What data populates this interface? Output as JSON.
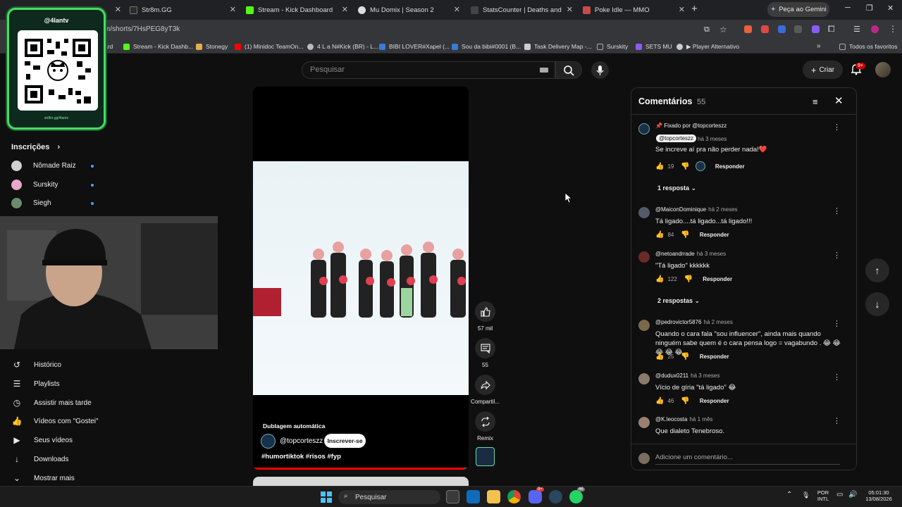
{
  "browser": {
    "tabs": [
      {
        "label": "",
        "color": "#555555"
      },
      {
        "label": "Str8m.GG",
        "color": "#2b2b2b"
      },
      {
        "label": "Stream - Kick Dashboard",
        "color": "#53fc18"
      },
      {
        "label": "Mu Domix | Season 2",
        "color": "#dddddd"
      },
      {
        "label": "StatsCounter | Deaths and trop",
        "color": "#444444"
      },
      {
        "label": "Poke Idle — MMO",
        "color": "#c94a4a"
      }
    ],
    "gemini_label": "Peça ao Gemini",
    "url": "m/shorts/7HsPEG8yT3k",
    "bookmarks": [
      {
        "label": "ard",
        "color": "#53fc18"
      },
      {
        "label": "Stream - Kick Dashb...",
        "color": "#53fc18"
      },
      {
        "label": "Stonegy",
        "color": "#e0b050"
      },
      {
        "label": "(1) Minidoc TeamOn...",
        "color": "#ff0000"
      },
      {
        "label": "4 L a N#Kick (BR) - L...",
        "color": "#bbbbbb"
      },
      {
        "label": "BIBI LOVER#Xapel (...",
        "color": "#3a7bd5"
      },
      {
        "label": "Sou da bibi#0001 (B...",
        "color": "#3a7bd5"
      },
      {
        "label": "Task Delivery Map -...",
        "color": "#cccccc"
      },
      {
        "label": "Surskity",
        "color": "#888888"
      },
      {
        "label": "SETS MU",
        "color": "#8b5cf6"
      },
      {
        "label": "▶ Player Alternativo",
        "color": "#cccccc"
      }
    ],
    "all_favorites": "Todos os favoritos"
  },
  "header": {
    "search_placeholder": "Pesquisar",
    "create_label": "Criar",
    "notif_badge": "9+"
  },
  "qr_overlay": {
    "title": "@4lantv",
    "link": "str8m.gg/4lantv"
  },
  "sidebar": {
    "subscriptions_title": "Inscrições",
    "subscriptions": [
      {
        "name": "Nômade Raiz",
        "color": "#cfcfcf"
      },
      {
        "name": "Surskity",
        "color": "#e9a8c8"
      },
      {
        "name": "Siegh",
        "color": "#6e8b6e"
      }
    ],
    "nav": [
      {
        "label": "Histórico",
        "icon": "history-icon",
        "glyph": "↺"
      },
      {
        "label": "Playlists",
        "icon": "playlists-icon",
        "glyph": "☰"
      },
      {
        "label": "Assistir mais tarde",
        "icon": "watch-later-icon",
        "glyph": "◷"
      },
      {
        "label": "Vídeos com \"Gostei\"",
        "icon": "thumbs-up-icon",
        "glyph": "👍"
      },
      {
        "label": "Seus vídeos",
        "icon": "your-videos-icon",
        "glyph": "▶"
      },
      {
        "label": "Downloads",
        "icon": "download-icon",
        "glyph": "↓"
      },
      {
        "label": "Mostrar mais",
        "icon": "chevron-down-icon",
        "glyph": "⌄"
      }
    ]
  },
  "video": {
    "auto_dub": "Dublagem automática",
    "channel": "@topcorteszz",
    "subscribe": "Inscrever-se",
    "hashtags": "#humortiktok #risos #fyp",
    "progress": 0.98
  },
  "actions": {
    "likes": "57 mil",
    "comments": "55",
    "share": "Compartil...",
    "remix": "Remix"
  },
  "comments": {
    "title": "Comentários",
    "count": "55",
    "pinned_by": "Fixado por @topcorteszz",
    "add_placeholder": "Adicione um comentário...",
    "reply_label": "Responder",
    "items": [
      {
        "author": "@topcorteszz",
        "time": "há 3 meses",
        "text": "Se increve aí pra não perder nada!❤️",
        "likes": "19",
        "replies": "1 resposta",
        "color": "#1b2f46"
      },
      {
        "author": "@MaiconDominique",
        "time": "há 2 meses",
        "text": "Tá ligado....tá ligado...tá ligado!!!",
        "likes": "84",
        "replies": "",
        "color": "#555a6a"
      },
      {
        "author": "@netoandrrade",
        "time": "há 3 meses",
        "text": "\"Tá ligado\" kkkkkk",
        "likes": "122",
        "replies": "2 respostas",
        "color": "#6a2a2a"
      },
      {
        "author": "@pedrovictor5876",
        "time": "há 2 meses",
        "text": "Quando o cara fala \"sou influencer\", ainda mais quando ninguém sabe quem é o cara pensa logo = vagabundo . 😂 😂 😂 😂 😂",
        "likes": "25",
        "replies": "",
        "color": "#7a6a4a"
      },
      {
        "author": "@dudux0211",
        "time": "há 3 meses",
        "text": "Vício de gíria \"tá ligado\" 😂",
        "likes": "46",
        "replies": "",
        "color": "#8a7a6a"
      },
      {
        "author": "@K.leocosta",
        "time": "há 1 mês",
        "text": "Que dialeto Tenebroso.",
        "likes": "",
        "replies": "",
        "color": "#9a8070"
      }
    ]
  },
  "taskbar": {
    "search_label": "Pesquisar",
    "lang_top": "POR",
    "lang_bottom": "INTL",
    "time": "05:01:30",
    "date": "13/08/2026",
    "discord_badge": "9+",
    "whatsapp_badge": "46"
  }
}
